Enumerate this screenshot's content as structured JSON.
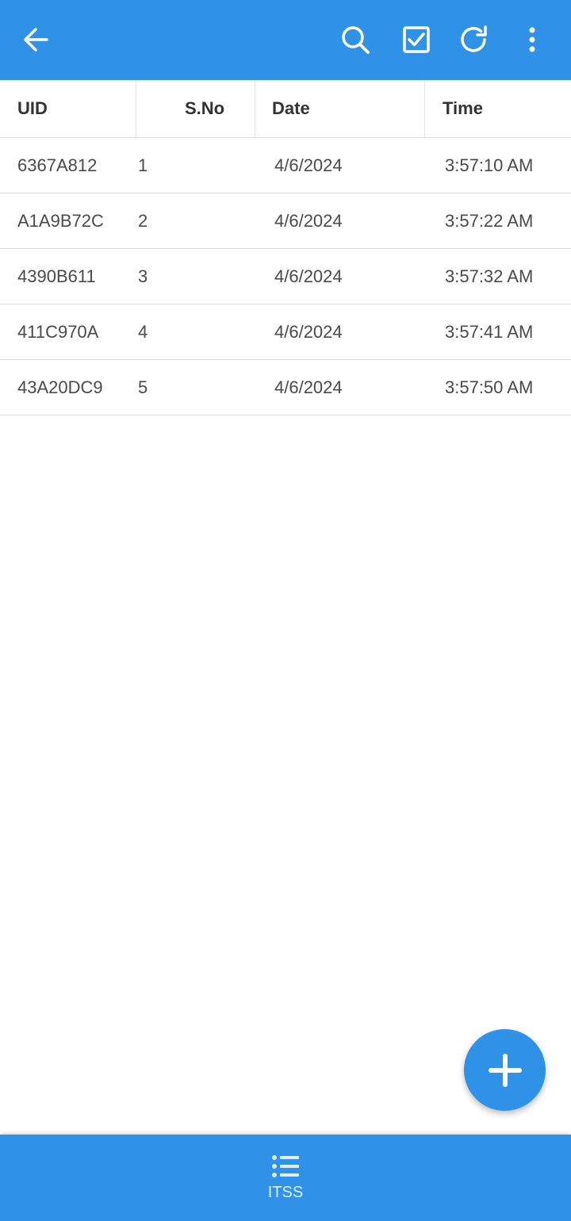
{
  "colors": {
    "accent": "#2f92e6",
    "text": "#4a4a4a",
    "header_text": "#333333",
    "divider": "#dcdcdc"
  },
  "toolbar": {
    "icons": [
      "back-arrow-icon",
      "search-icon",
      "checkbox-icon",
      "refresh-icon",
      "more-vert-icon"
    ]
  },
  "table": {
    "headers": {
      "uid": "UID",
      "sno": "S.No",
      "date": "Date",
      "time": "Time"
    },
    "rows": [
      {
        "uid": "6367A812",
        "sno": "1",
        "date": "4/6/2024",
        "time": "3:57:10 AM"
      },
      {
        "uid": "A1A9B72C",
        "sno": "2",
        "date": "4/6/2024",
        "time": "3:57:22 AM"
      },
      {
        "uid": "4390B611",
        "sno": "3",
        "date": "4/6/2024",
        "time": "3:57:32 AM"
      },
      {
        "uid": "411C970A",
        "sno": "4",
        "date": "4/6/2024",
        "time": "3:57:41 AM"
      },
      {
        "uid": "43A20DC9",
        "sno": "5",
        "date": "4/6/2024",
        "time": "3:57:50 AM"
      }
    ]
  },
  "fab": {
    "icon": "plus-icon"
  },
  "bottom_nav": {
    "items": [
      {
        "label": "ITSS",
        "icon": "list-icon"
      }
    ]
  }
}
